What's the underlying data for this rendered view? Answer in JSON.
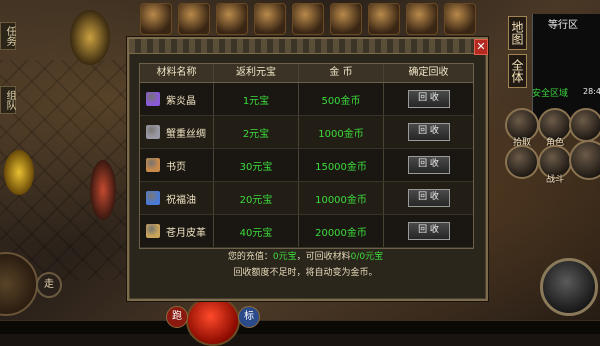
{
  "side_tabs": {
    "tasks": "任务",
    "team": "组队"
  },
  "map_tabs": {
    "map": "地图",
    "all": "全体"
  },
  "minimap": {
    "title": "等行区",
    "zone": "安全区域",
    "coord": "28:4"
  },
  "skills": {
    "pickup": "拾取",
    "role": "角色",
    "combat": "战斗"
  },
  "bottom": {
    "walk": "走",
    "attack_mode": "跑",
    "mark": "标"
  },
  "panel": {
    "close_glyph": "✕",
    "headers": [
      "材料名称",
      "返利元宝",
      "金 币",
      "确定回收"
    ],
    "rows": [
      {
        "name": "紫炎晶",
        "rebate": "1元宝",
        "gold": "500金币",
        "button": "回 收",
        "icon": "purple-crystal-icon",
        "icon_color": "#8a5ad6"
      },
      {
        "name": "蟹重丝绸",
        "rebate": "2元宝",
        "gold": "1000金币",
        "button": "回 收",
        "icon": "silk-icon",
        "icon_color": "#9a9aa6"
      },
      {
        "name": "书页",
        "rebate": "30元宝",
        "gold": "15000金币",
        "button": "回 收",
        "icon": "book-page-icon",
        "icon_color": "#c98a4a"
      },
      {
        "name": "祝福油",
        "rebate": "20元宝",
        "gold": "10000金币",
        "button": "回 收",
        "icon": "blessing-oil-icon",
        "icon_color": "#4a7ad6"
      },
      {
        "name": "苍月皮革",
        "rebate": "40元宝",
        "gold": "20000金币",
        "button": "回 收",
        "icon": "leather-icon",
        "icon_color": "#c9a45a"
      }
    ],
    "footer": {
      "recharge_label": "您的充值：",
      "recharge_value": "0元宝",
      "recycle_label": "，可回收材料",
      "recycle_value": "0/0元宝",
      "note": "回收额度不足时，将自动变为金币。"
    }
  },
  "colors": {
    "accent_green": "#3cdc3c",
    "panel_border": "#7d6c4c",
    "close_red": "#b42a20"
  }
}
